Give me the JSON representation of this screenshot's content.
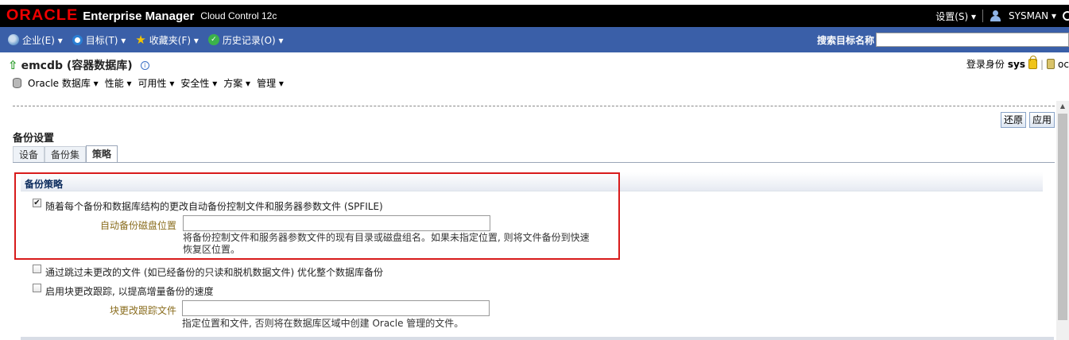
{
  "topbar": {
    "logo": "ORACLE",
    "title": "Enterprise Manager",
    "subtitle": "Cloud Control 12c",
    "settings": "设置(S) ▾",
    "user": "SYSMAN ▾"
  },
  "menubar": {
    "items": [
      {
        "label": "企业(E) ▾"
      },
      {
        "label": "目标(T) ▾"
      },
      {
        "label": "收藏夹(F) ▾"
      },
      {
        "label": "历史记录(O) ▾"
      }
    ],
    "search_label": "搜索目标名称",
    "search_value": ""
  },
  "page": {
    "db_title": "emcdb (容器数据库)",
    "login_label": "登录身份",
    "login_user": "sys",
    "login_tail": "oc",
    "submenu": [
      "Oracle 数据库 ▾",
      "性能 ▾",
      "可用性 ▾",
      "安全性 ▾",
      "方案 ▾",
      "管理 ▾"
    ]
  },
  "buttons": {
    "restore": "还原",
    "apply": "应用"
  },
  "section_title": "备份设置",
  "tabs": [
    {
      "label": "设备",
      "active": false
    },
    {
      "label": "备份集",
      "active": false
    },
    {
      "label": "策略",
      "active": true
    }
  ],
  "policy": {
    "title": "备份策略",
    "autobackup": {
      "checked": true,
      "label": "随着每个备份和数据库结构的更改自动备份控制文件和服务器参数文件 (SPFILE)",
      "field_label": "自动备份磁盘位置",
      "field_value": "",
      "hint_line1": "将备份控制文件和服务器参数文件的现有目录或磁盘组名。如果未指定位置, 则将文件备份到快速",
      "hint_line2": "恢复区位置。"
    },
    "skip_unchanged": {
      "checked": false,
      "label": "通过跳过未更改的文件 (如已经备份的只读和脱机数据文件) 优化整个数据库备份"
    },
    "block_tracking": {
      "checked": false,
      "label": "启用块更改跟踪, 以提高增量备份的速度",
      "field_label": "块更改跟踪文件",
      "field_value": "",
      "hint": "指定位置和文件, 否则将在数据库区域中创建 Oracle 管理的文件。"
    }
  },
  "colors": {
    "menubar": "#3a5fa8",
    "logo_red": "#e00000",
    "highlight_box": "#d81b1b",
    "field_label": "#8a6d1e"
  }
}
